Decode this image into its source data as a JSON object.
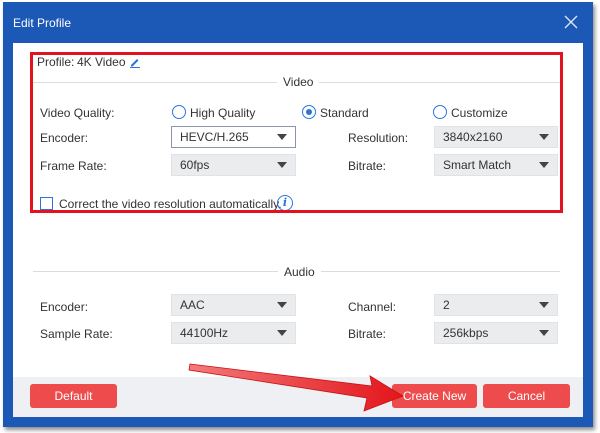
{
  "window": {
    "title": "Edit Profile"
  },
  "profile": {
    "label": "Profile:",
    "value": "4K Video"
  },
  "video": {
    "section_title": "Video",
    "quality": {
      "label": "Video Quality:",
      "options": [
        "High Quality",
        "Standard",
        "Customize"
      ],
      "selected": "Standard"
    },
    "encoder": {
      "label": "Encoder:",
      "value": "HEVC/H.265"
    },
    "frame_rate": {
      "label": "Frame Rate:",
      "value": "60fps"
    },
    "resolution": {
      "label": "Resolution:",
      "value": "3840x2160"
    },
    "bitrate": {
      "label": "Bitrate:",
      "value": "Smart Match"
    },
    "auto_correct": {
      "label": "Correct the video resolution automatically.",
      "checked": false
    },
    "info_glyph": "i"
  },
  "audio": {
    "section_title": "Audio",
    "encoder": {
      "label": "Encoder:",
      "value": "AAC"
    },
    "sample_rate": {
      "label": "Sample Rate:",
      "value": "44100Hz"
    },
    "channel": {
      "label": "Channel:",
      "value": "2"
    },
    "bitrate": {
      "label": "Bitrate:",
      "value": "256kbps"
    }
  },
  "footer": {
    "default_label": "Default",
    "create_new_label": "Create New",
    "cancel_label": "Cancel"
  },
  "colors": {
    "titlebar": "#1c58b5",
    "accent": "#2a74e2",
    "button": "#ee4c4c",
    "highlight_box": "#e2131f"
  },
  "icons": [
    "close-icon",
    "pencil-icon",
    "info-icon",
    "chevron-down-icon",
    "annotation-arrow"
  ]
}
